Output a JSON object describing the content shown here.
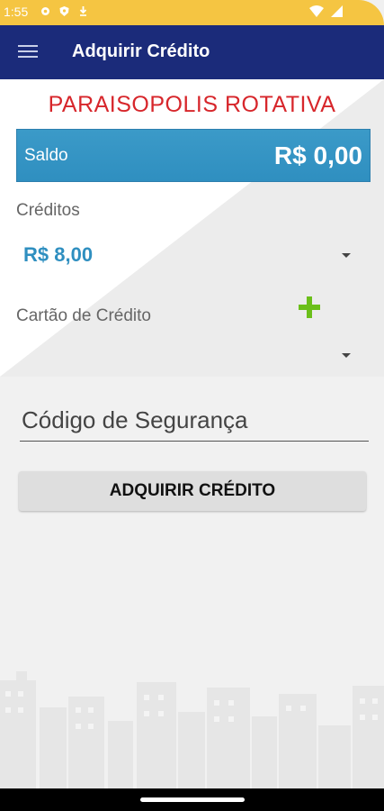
{
  "status_bar": {
    "time": "1:55",
    "icons_left": [
      "gear-icon",
      "shield-icon",
      "download-icon"
    ],
    "icons_right": [
      "wifi-icon",
      "signal-icon"
    ],
    "color": "#f5c542"
  },
  "app_bar": {
    "title": "Adquirir Crédito",
    "menu_icon": "menu-icon",
    "color": "#1b2b7a"
  },
  "main": {
    "org_name": "PARAISOPOLIS ROTATIVA",
    "saldo": {
      "label": "Saldo",
      "value": "R$ 0,00"
    },
    "creditos": {
      "label": "Créditos",
      "selected": "R$ 8,00"
    },
    "cartao": {
      "label": "Cartão de Crédito",
      "selected": ""
    },
    "security_code": {
      "placeholder": "Código de Segurança",
      "value": ""
    },
    "buy_button": "ADQUIRIR CRÉDITO"
  },
  "colors": {
    "accent_blue": "#2f8fc0",
    "org_red": "#d7262b",
    "add_green": "#6bbf1a"
  }
}
